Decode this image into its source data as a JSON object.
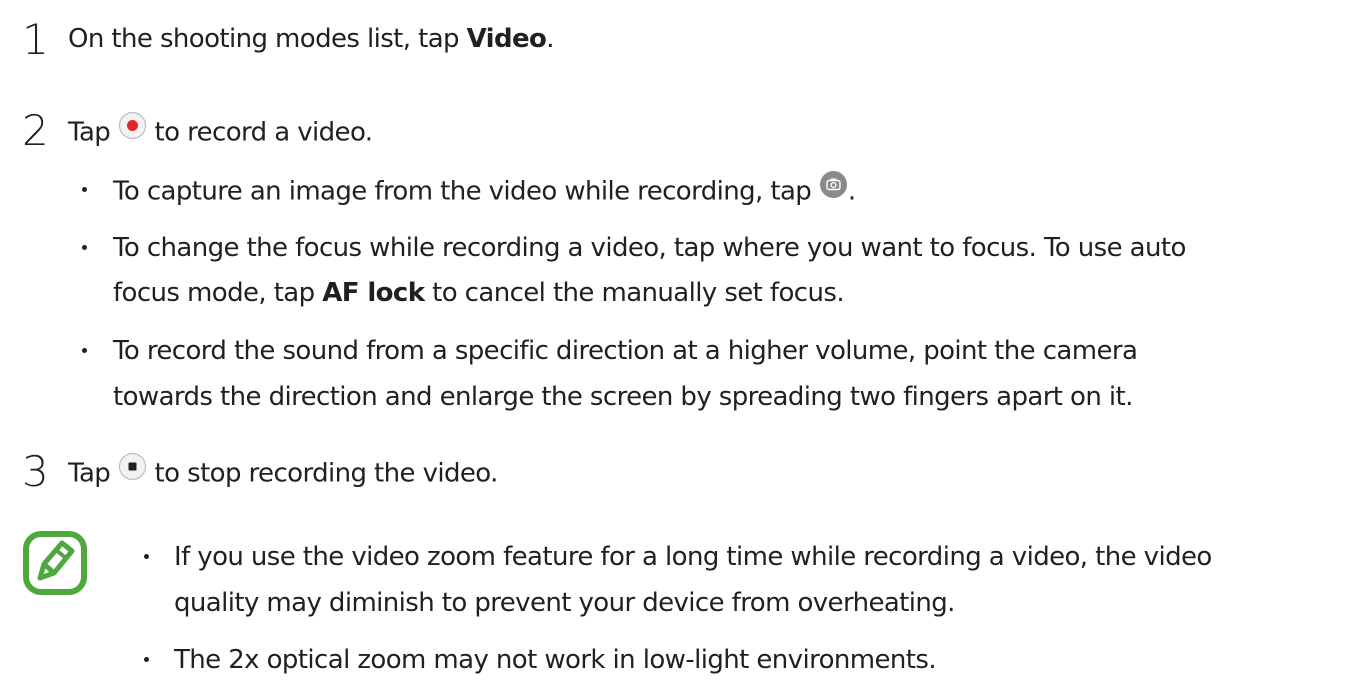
{
  "steps": [
    {
      "number": "1",
      "before": "On the shooting modes list, tap ",
      "bold": "Video",
      "after": "."
    },
    {
      "number": "2",
      "before": "Tap ",
      "icon": "record-button-icon",
      "after": " to record a video.",
      "bullets": [
        {
          "before": "To capture an image from the video while recording, tap ",
          "icon": "capture-camera-icon",
          "after": "."
        },
        {
          "line1": "To change the focus while recording a video, tap where you want to focus. To use auto",
          "line2_before": "focus mode, tap ",
          "line2_bold": "AF lock",
          "line2_after": " to cancel the manually set focus."
        },
        {
          "line1": "To record the sound from a specific direction at a higher volume, point the camera",
          "line2": "towards the direction and enlarge the screen by spreading two fingers apart on it."
        }
      ]
    },
    {
      "number": "3",
      "before": "Tap ",
      "icon": "stop-button-icon",
      "after": " to stop recording the video."
    }
  ],
  "note": {
    "icon": "note-pencil-icon",
    "icon_color": "#4fa83d",
    "bullets": [
      {
        "line1": "If you use the video zoom feature for a long time while recording a video, the video",
        "line2": "quality may diminish to prevent your device from overheating."
      },
      {
        "line1": "The 2x optical zoom may not work in low-light environments."
      }
    ]
  },
  "colors": {
    "text": "#231f20",
    "record_red": "#e0262b",
    "note_green": "#4fa83d"
  }
}
